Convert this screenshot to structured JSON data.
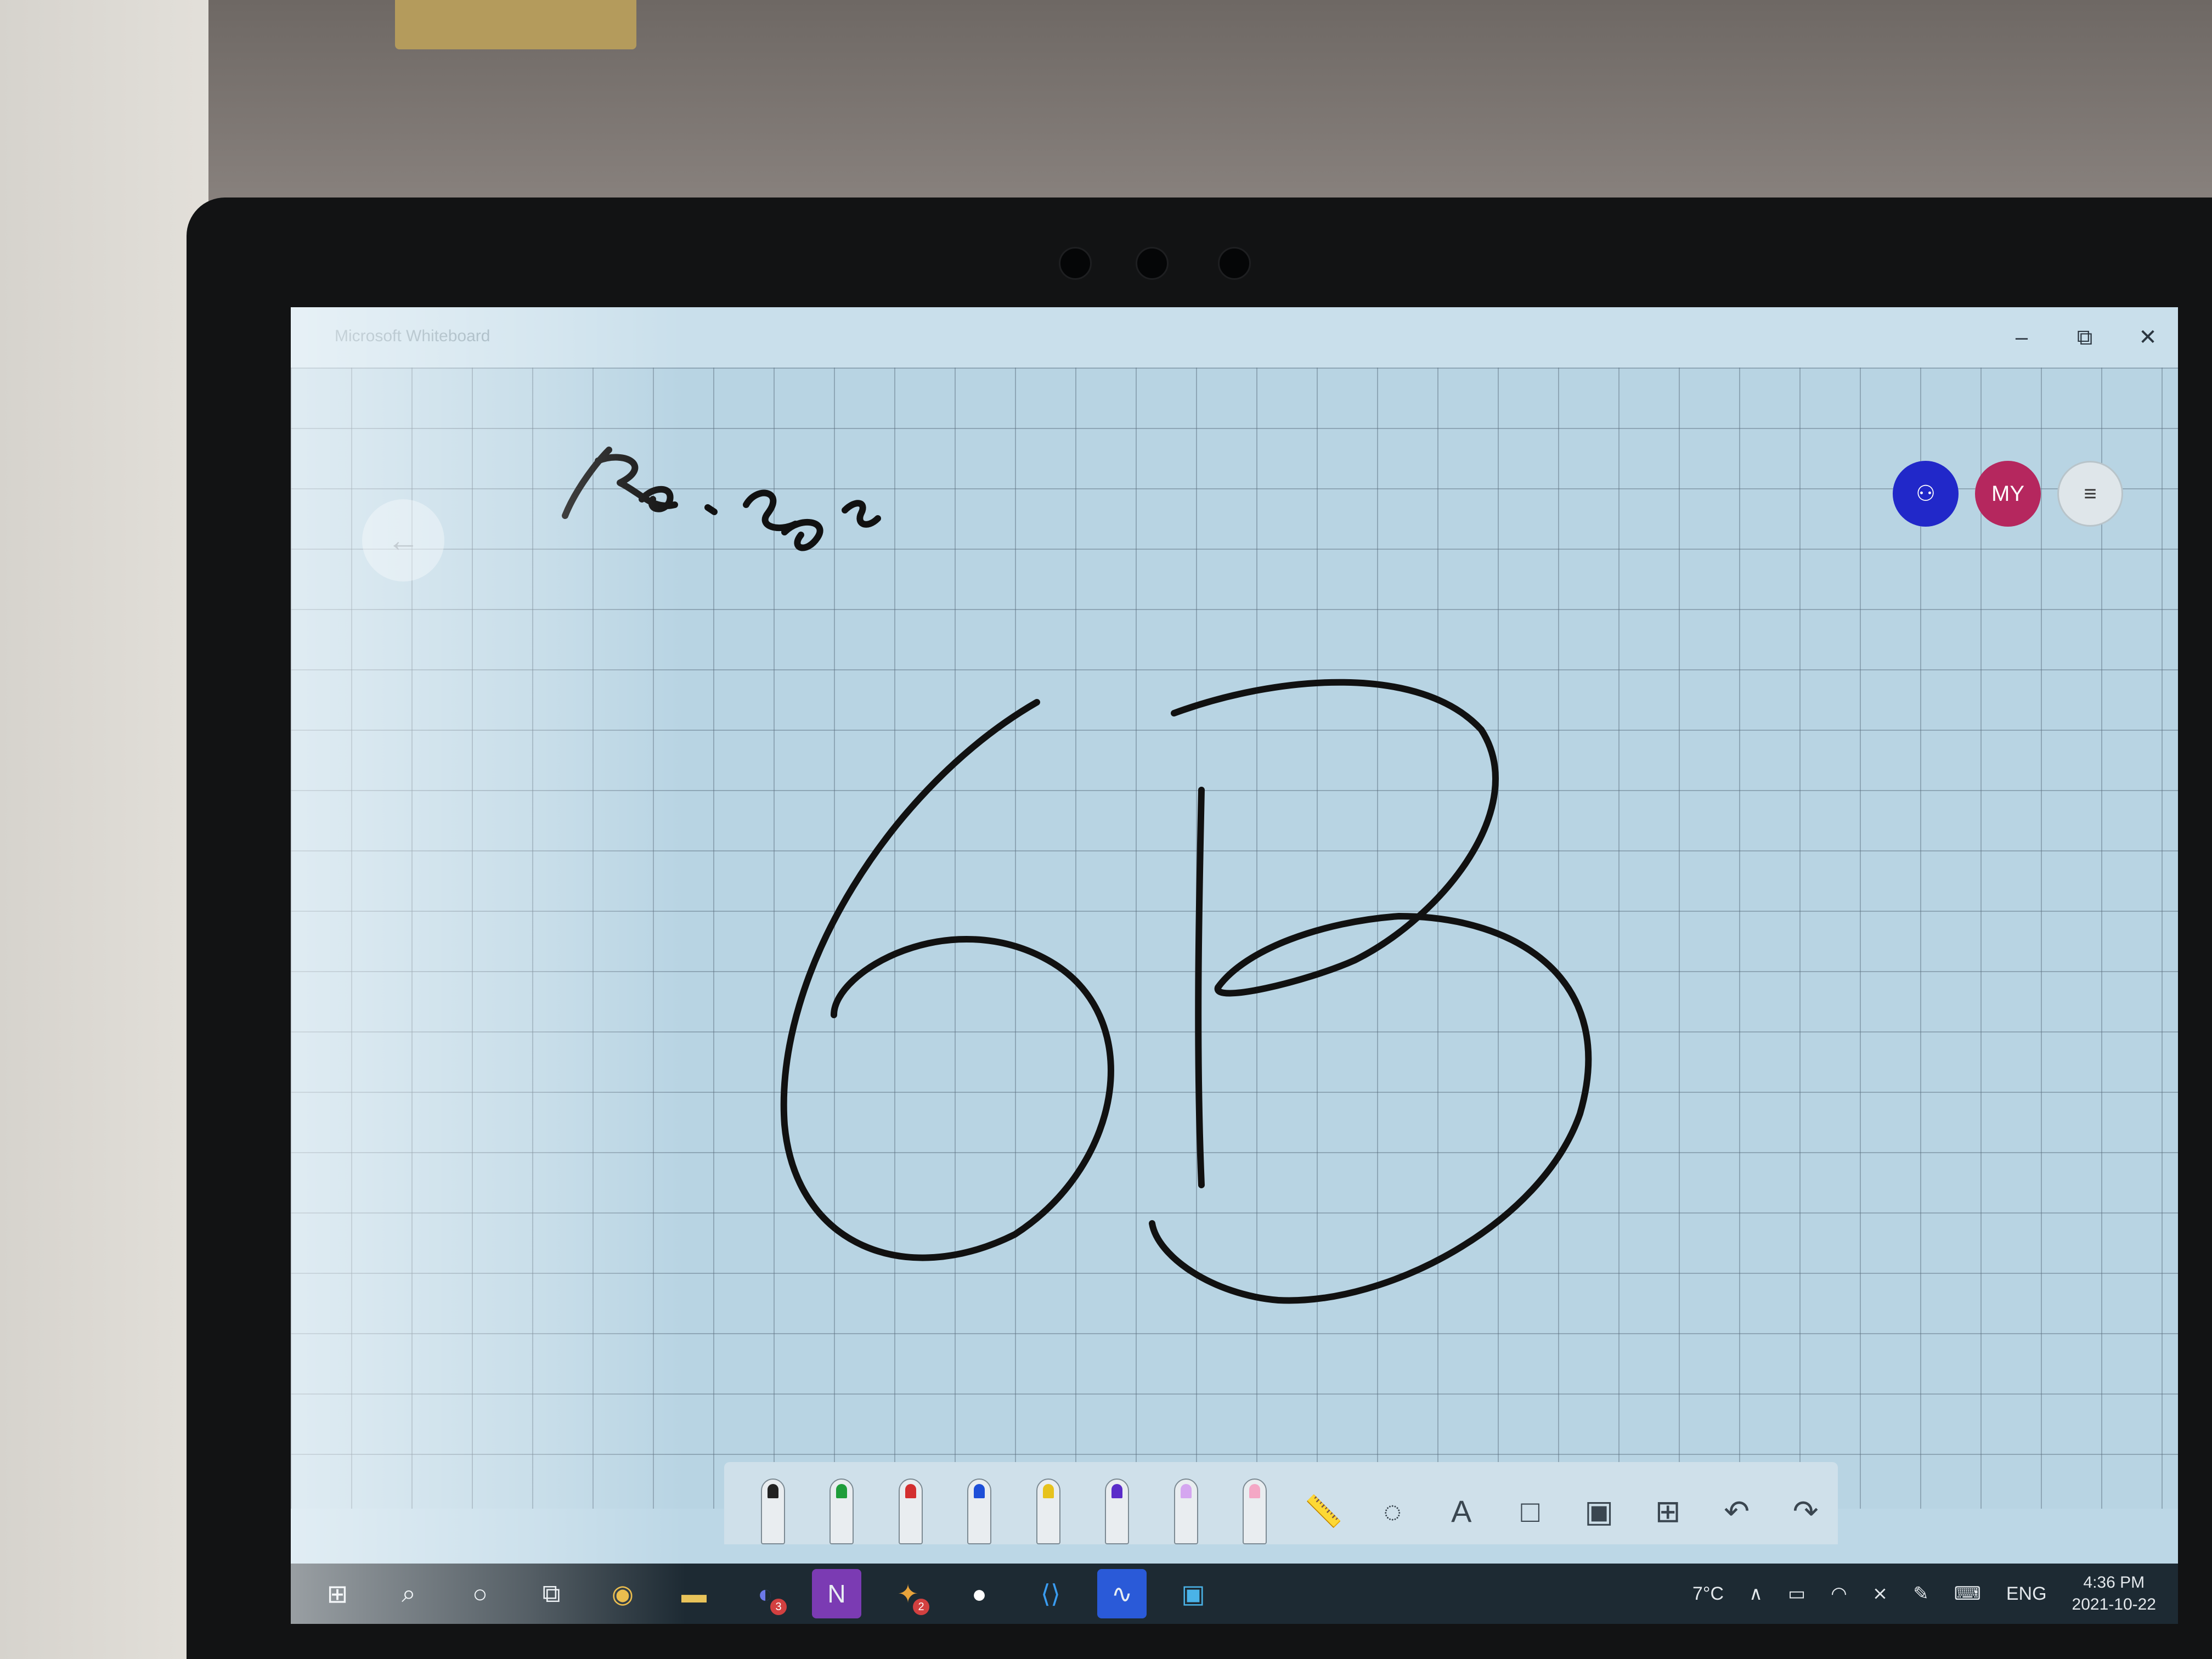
{
  "window": {
    "title": "Microsoft Whiteboard",
    "minimize_glyph": "–",
    "restore_glyph": "⧉",
    "close_glyph": "✕"
  },
  "nav": {
    "back_glyph": "←"
  },
  "participants": {
    "invite_icon": "person-add",
    "invite_glyph": "⚇",
    "user_initials": "MY",
    "menu_glyph": "≡"
  },
  "canvas": {
    "ink_color": "#111111",
    "grid": true
  },
  "toolbar": {
    "tools": [
      {
        "name": "pen-black",
        "color": "#222222"
      },
      {
        "name": "pen-green",
        "color": "#1f9d3a"
      },
      {
        "name": "pen-red",
        "color": "#d32f2f"
      },
      {
        "name": "pen-blue",
        "color": "#1e4fd8"
      },
      {
        "name": "pen-yellow",
        "color": "#e7c21c"
      },
      {
        "name": "pen-purple",
        "color": "#5b2cc9"
      },
      {
        "name": "highlighter",
        "color": "#d5a6f0"
      },
      {
        "name": "eraser",
        "color": "#f4a7c5"
      }
    ],
    "ruler_glyph": "📏",
    "lasso_glyph": "◌",
    "text_glyph": "A",
    "note_glyph": "□",
    "image_glyph": "▣",
    "insert_glyph": "⊞",
    "undo_glyph": "↶",
    "redo_glyph": "↷"
  },
  "taskbar": {
    "start_glyph": "⊞",
    "search_glyph": "⌕",
    "cortana_glyph": "○",
    "taskview_glyph": "⧉",
    "chrome_glyph": "◉",
    "explorer_glyph": "▬",
    "discord_glyph": "◐",
    "discord_badge": "3",
    "onenote_glyph": "N",
    "slack_glyph": "✦",
    "slack_badge": "2",
    "github_glyph": "●",
    "vscode_glyph": "⟨⟩",
    "whiteboard_glyph": "∿",
    "remote_glyph": "▣"
  },
  "tray": {
    "weather": "7°C",
    "chevron_glyph": "∧",
    "battery_glyph": "▭",
    "wifi_glyph": "◠",
    "volume_glyph": "⨯",
    "pen_glyph": "✎",
    "keyboard_glyph": "⌨",
    "language": "ENG",
    "time": "4:36 PM",
    "date": "2021-10-22"
  }
}
